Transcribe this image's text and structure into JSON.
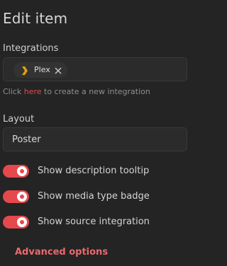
{
  "title": "Edit item",
  "integrations": {
    "label": "Integrations",
    "chips": [
      {
        "label": "Plex",
        "icon": "plex-chevron-icon",
        "remove_icon": "close-icon"
      }
    ],
    "helper_prefix": "Click",
    "helper_link": "here",
    "helper_suffix": "to create a new integration"
  },
  "layout": {
    "label": "Layout",
    "value": "Poster"
  },
  "switches": [
    {
      "label": "Show description tooltip",
      "checked": true
    },
    {
      "label": "Show media type badge",
      "checked": true
    },
    {
      "label": "Show source integration",
      "checked": true
    }
  ],
  "advanced_label": "Advanced options",
  "colors": {
    "background": "#242424",
    "accent": "#e5484d",
    "plex": "#e5a00d"
  }
}
